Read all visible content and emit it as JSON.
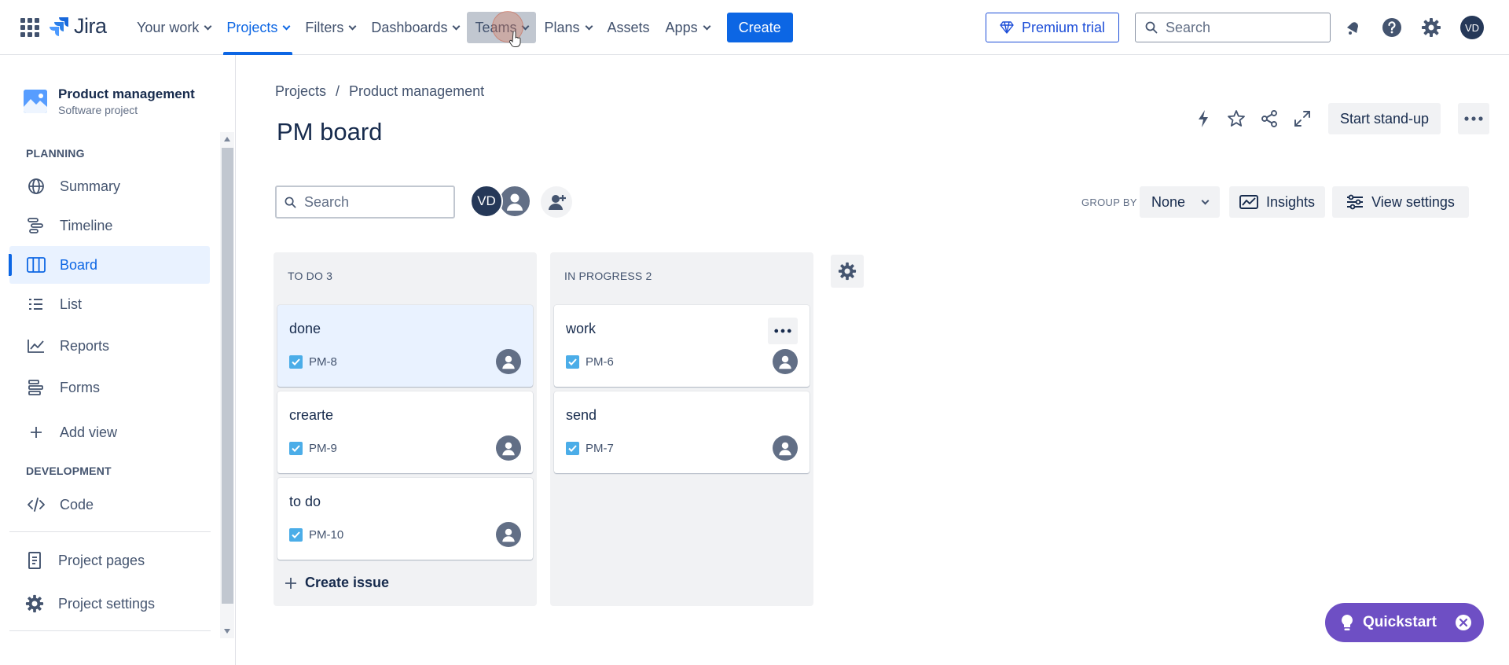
{
  "topnav": {
    "logo_text": "Jira",
    "items": [
      {
        "label": "Your work",
        "dropdown": true
      },
      {
        "label": "Projects",
        "dropdown": true
      },
      {
        "label": "Filters",
        "dropdown": true
      },
      {
        "label": "Dashboards",
        "dropdown": true
      },
      {
        "label": "Teams",
        "dropdown": true
      },
      {
        "label": "Plans",
        "dropdown": true
      },
      {
        "label": "Assets",
        "dropdown": false
      },
      {
        "label": "Apps",
        "dropdown": true
      }
    ],
    "active_item": "Projects",
    "hovered_item": "Teams",
    "create_label": "Create",
    "premium_label": "Premium trial",
    "search_placeholder": "Search",
    "avatar_initials": "VD",
    "icons": [
      "app-switcher-icon",
      "notifications-icon",
      "help-icon",
      "settings-icon"
    ]
  },
  "sidebar": {
    "project_name": "Product management",
    "project_type": "Software project",
    "planning_label": "PLANNING",
    "planning_items": [
      {
        "label": "Summary",
        "icon": "globe-icon"
      },
      {
        "label": "Timeline",
        "icon": "timeline-icon"
      },
      {
        "label": "Board",
        "icon": "board-icon",
        "selected": true
      },
      {
        "label": "List",
        "icon": "list-icon"
      },
      {
        "label": "Reports",
        "icon": "reports-icon"
      },
      {
        "label": "Forms",
        "icon": "forms-icon"
      }
    ],
    "add_view_label": "Add view",
    "development_label": "DEVELOPMENT",
    "code_label": "Code",
    "project_pages_label": "Project pages",
    "project_settings_label": "Project settings"
  },
  "main": {
    "breadcrumb": [
      "Projects",
      "Product management"
    ],
    "breadcrumb_sep": "/",
    "title": "PM board",
    "standup_label": "Start stand-up",
    "search_placeholder": "Search",
    "avatar_initials": "VD",
    "group_by_label": "GROUP BY",
    "group_by_value": "None",
    "insights_label": "Insights",
    "view_settings_label": "View settings",
    "columns": [
      {
        "title": "TO DO 3",
        "cards": [
          {
            "title": "done",
            "key": "PM-8"
          },
          {
            "title": "crearte",
            "key": "PM-9"
          },
          {
            "title": "to do",
            "key": "PM-10"
          }
        ],
        "create_issue_label": "Create issue"
      },
      {
        "title": "IN PROGRESS 2",
        "cards": [
          {
            "title": "work",
            "key": "PM-6"
          },
          {
            "title": "send",
            "key": "PM-7"
          }
        ]
      }
    ],
    "quickstart_label": "Quickstart"
  },
  "colors": {
    "brand_blue": "#0c66e4",
    "quickstart_purple": "#6e4fc4",
    "column_bg": "#f1f2f4",
    "task_icon": "#4bade8"
  }
}
